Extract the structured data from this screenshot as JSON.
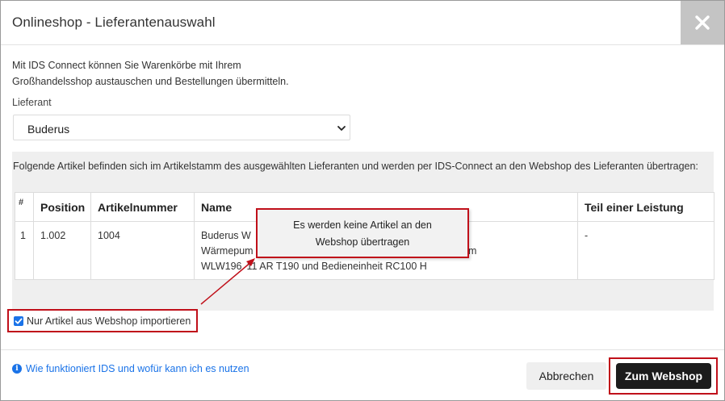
{
  "dialog": {
    "title": "Onlineshop - Lieferantenauswahl",
    "intro_line1": "Mit IDS Connect können Sie Warenkörbe mit Ihrem",
    "intro_line2": "Großhandelsshop austauschen und Bestellungen übermitteln.",
    "supplier_label": "Lieferant",
    "supplier_value": "Buderus",
    "info_text": "Folgende Artikel befinden sich im Artikelstamm des ausgewählten Lieferanten und werden per IDS-Connect an den Webshop des Lieferanten übertragen:"
  },
  "table": {
    "headers": [
      "#",
      "Position",
      "Artikelnummer",
      "Name",
      "Teil einer Leistung"
    ],
    "rows": [
      {
        "index": "1",
        "position": "1.002",
        "artikelnummer": "1004",
        "name_line1": "Buderus W",
        "name_line2": "Wärmepum",
        "name_line2_tail": "Logatherm",
        "name_line3_head": "WLW196",
        "name_line3_tail": "11 AR T190 und Bedieneinheit RC100 H",
        "teil": "-"
      }
    ]
  },
  "checkbox": {
    "label": "Nur Artikel aus Webshop importieren",
    "checked": true
  },
  "callout": {
    "line1": "Es werden keine Artikel an den",
    "line2": "Webshop übertragen"
  },
  "footer": {
    "help_link": "Wie funktioniert IDS und wofür kann ich es nutzen",
    "cancel_label": "Abbrechen",
    "webshop_label": "Zum Webshop"
  },
  "colors": {
    "accent_blue": "#1a73e8",
    "highlight_red": "#c0101a",
    "primary_button": "#1c1c1c"
  },
  "icons": [
    "close-icon",
    "chevron-down-icon",
    "info-icon",
    "check-icon"
  ]
}
